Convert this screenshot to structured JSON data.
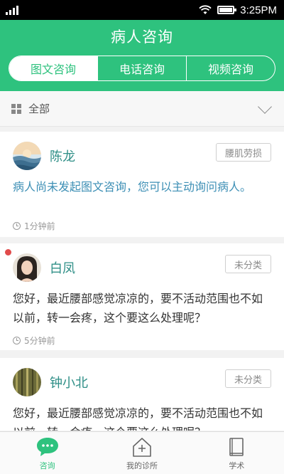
{
  "status_bar": {
    "time": "3:25PM"
  },
  "header": {
    "title": "病人咨询",
    "tabs": [
      {
        "label": "图文咨询",
        "active": true
      },
      {
        "label": "电话咨询",
        "active": false
      },
      {
        "label": "视频咨询",
        "active": false
      }
    ]
  },
  "filter": {
    "label": "全部"
  },
  "consultations": [
    {
      "name": "陈龙",
      "tag": "腰肌劳损",
      "message": "病人尚未发起图文咨询，您可以主动询问病人。",
      "time": "1分钟前",
      "unread": false
    },
    {
      "name": "白凤",
      "tag": "未分类",
      "message": "您好，最近腰部感觉凉凉的，要不活动范围也不如以前，转一会疼，这个要这么处理呢？",
      "time": "5分钟前",
      "unread": true
    },
    {
      "name": "钟小北",
      "tag": "未分类",
      "message": "您好，最近腰部感觉凉凉的，要不活动范围也不如以前，转一会疼，这个要这么处理呢？",
      "time": "",
      "unread": false
    }
  ],
  "bottom_nav": [
    {
      "label": "咨询",
      "icon": "chat-bubble-icon",
      "active": true
    },
    {
      "label": "我的诊所",
      "icon": "clinic-house-icon",
      "active": false
    },
    {
      "label": "学术",
      "icon": "book-icon",
      "active": false
    }
  ],
  "colors": {
    "brand_green": "#2ec27e",
    "name_teal": "#2f8f87",
    "notice_blue": "#3d8fb5",
    "unread_red": "#e14b4b"
  }
}
